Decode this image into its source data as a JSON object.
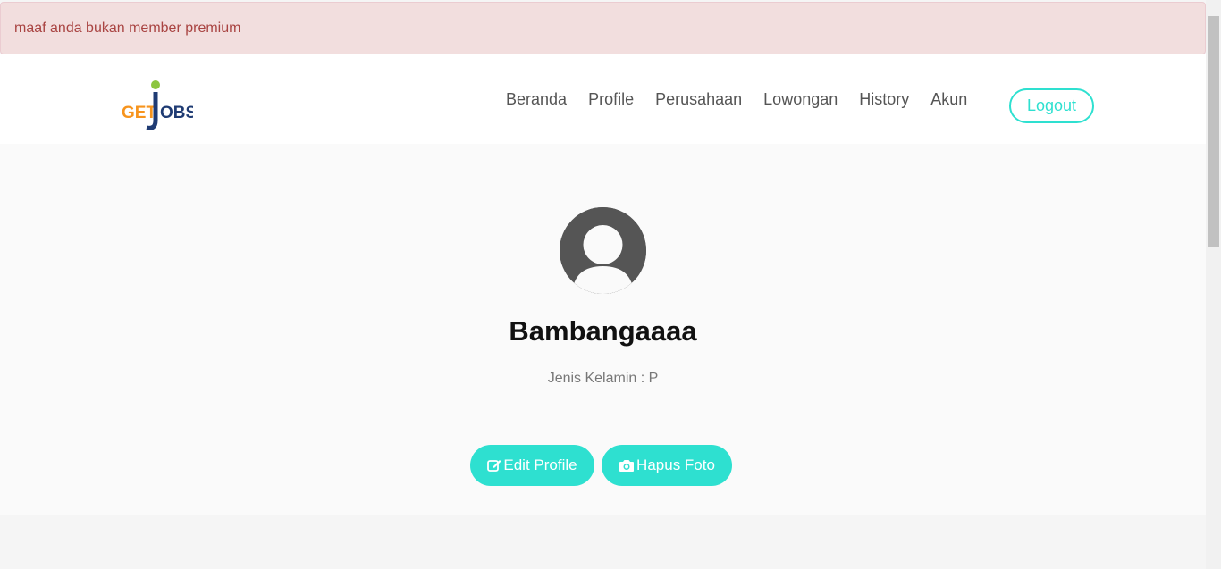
{
  "alert": {
    "message": "maaf anda bukan member premium"
  },
  "navbar": {
    "logo_text": "GETJOBS",
    "links": [
      "Beranda",
      "Profile",
      "Perusahaan",
      "Lowongan",
      "History",
      "Akun"
    ],
    "logout_label": "Logout"
  },
  "profile": {
    "name": "Bambangaaaa",
    "gender_line": "Jenis Kelamin : P",
    "edit_label": "Edit Profile",
    "delete_photo_label": "Hapus Foto"
  },
  "colors": {
    "accent": "#2ee0d0",
    "alert_bg": "#f2dede",
    "alert_text": "#a94442",
    "logo_orange": "#f7941d",
    "logo_navy": "#1f3b73",
    "logo_green": "#8dc63f"
  },
  "icons": {
    "edit": "edit-icon",
    "camera": "camera-icon",
    "avatar": "user-placeholder-icon"
  }
}
